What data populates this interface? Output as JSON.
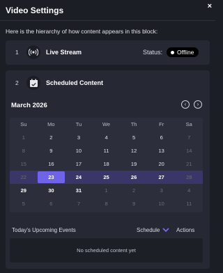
{
  "header": {
    "title": "Video Settings",
    "close_glyph": "×"
  },
  "subtitle": "Here is the hierarchy of how content appears in this block:",
  "live": {
    "number": "1",
    "icon": "broadcast-icon",
    "label": "Live Stream",
    "status_label": "Status:",
    "status_value": "Offline"
  },
  "scheduled": {
    "number": "2",
    "icon": "calendar-check-icon",
    "label": "Scheduled Content"
  },
  "calendar": {
    "month": "March 2026",
    "prev_glyph": "‹",
    "next_glyph": "›",
    "weekdays": [
      "Su",
      "Mo",
      "Tu",
      "We",
      "Th",
      "Fr",
      "Sa"
    ],
    "weeks": [
      [
        "1",
        "2",
        "3",
        "4",
        "5",
        "6",
        "7"
      ],
      [
        "8",
        "9",
        "10",
        "11",
        "12",
        "13",
        "14"
      ],
      [
        "15",
        "16",
        "17",
        "18",
        "19",
        "20",
        "21"
      ],
      [
        "22",
        "23",
        "24",
        "25",
        "26",
        "27",
        "28"
      ],
      [
        "29",
        "30",
        "31",
        "1",
        "2",
        "3",
        "4"
      ],
      [
        "5",
        "6",
        "7",
        "8",
        "9",
        "10",
        "11"
      ]
    ],
    "selected_date": "23"
  },
  "events": {
    "heading": "Today's Upcoming Events",
    "schedule_label": "Schedule",
    "actions_label": "Actions",
    "empty_text": "No scheduled content yet"
  },
  "colors": {
    "accent": "#6f63e9",
    "background": "#1c1e26",
    "card": "#262934"
  }
}
